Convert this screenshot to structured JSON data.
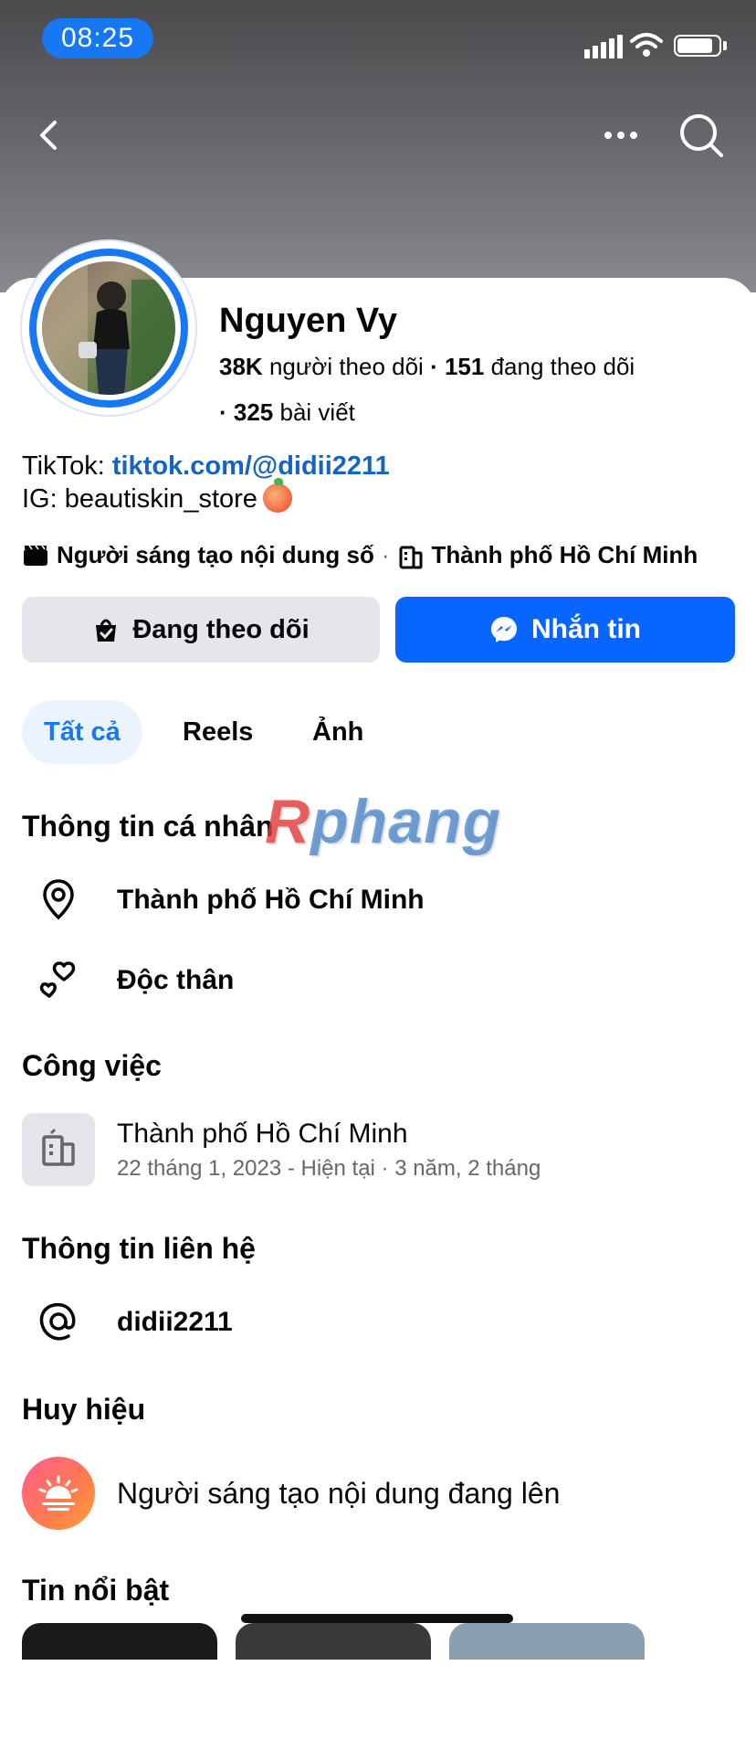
{
  "status_bar": {
    "time": "08:25"
  },
  "nav": {
    "back_icon": "chevron-left-icon",
    "more_icon": "more-icon",
    "search_icon": "search-icon"
  },
  "profile": {
    "name": "Nguyen Vy",
    "followers_count": "38K",
    "followers_label": "người theo dõi",
    "following_count": "151",
    "following_label": "đang theo dõi",
    "posts_count": "325",
    "posts_label": "bài viết",
    "bio_tiktok_prefix": "TikTok: ",
    "bio_tiktok_link": "tiktok.com/@didii2211",
    "bio_ig": "IG: beautiskin_store",
    "category": "Người sáng tạo nội dung số",
    "location": "Thành phố Hồ Chí Minh"
  },
  "actions": {
    "follow_label": "Đang theo dõi",
    "message_label": "Nhắn tin"
  },
  "tabs": [
    {
      "label": "Tất cả",
      "active": true
    },
    {
      "label": "Reels"
    },
    {
      "label": "Ảnh"
    }
  ],
  "watermark": {
    "first": "R",
    "rest": "phang"
  },
  "personal_info": {
    "title": "Thông tin cá nhân",
    "items": [
      {
        "icon": "location-pin-icon",
        "text": "Thành phố Hồ Chí Minh"
      },
      {
        "icon": "relationship-hearts-icon",
        "text": "Độc thân"
      }
    ]
  },
  "work": {
    "title": "Công việc",
    "place": "Thành phố Hồ Chí Minh",
    "detail": "22 tháng 1, 2023 - Hiện tại · 3 năm, 2 tháng"
  },
  "contact": {
    "title": "Thông tin liên hệ",
    "username": "didii2211"
  },
  "badges": {
    "title": "Huy hiệu",
    "item": "Người sáng tạo nội dung đang lên"
  },
  "featured": {
    "title": "Tin nổi bật"
  },
  "colors": {
    "accent": "#1877f2",
    "button_primary": "#0866ff",
    "link": "#1565c0",
    "secondary_text": "#65676b"
  }
}
